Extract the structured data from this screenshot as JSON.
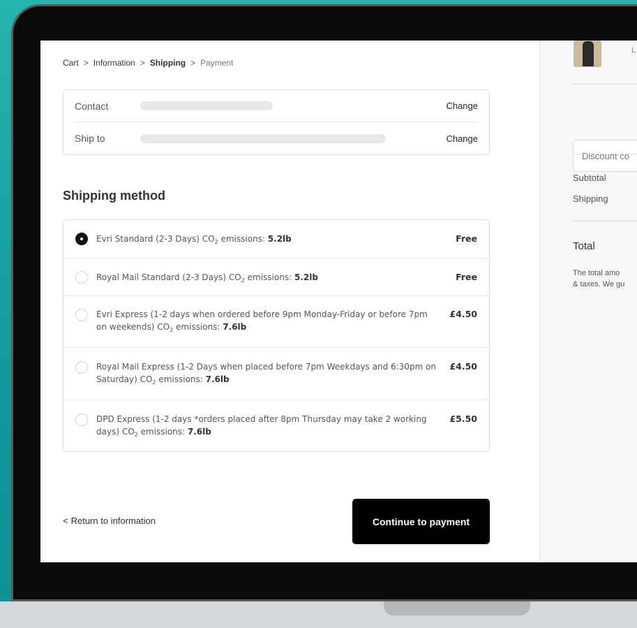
{
  "breadcrumb": {
    "items": [
      "Cart",
      "Information",
      "Shipping",
      "Payment"
    ],
    "separator": ">"
  },
  "summary": {
    "contact_label": "Contact",
    "ship_to_label": "Ship to",
    "change_label": "Change"
  },
  "shipping": {
    "title": "Shipping method",
    "methods": [
      {
        "name": "Evri Standard (2-3 Days)",
        "co2_prefix": "CO",
        "co2_sub": "2",
        "co2_suffix": " emissions: ",
        "co2_value": "5.2lb",
        "price": "Free",
        "selected": true
      },
      {
        "name": "Royal Mail Standard (2-3 Days)",
        "co2_prefix": "CO",
        "co2_sub": "2",
        "co2_suffix": " emissions: ",
        "co2_value": "5.2lb",
        "price": "Free",
        "selected": false
      },
      {
        "name": "Evri Express (1-2 days when ordered before 9pm Monday-Friday or before 7pm on weekends)",
        "co2_prefix": "CO",
        "co2_sub": "2",
        "co2_suffix": " emissions: ",
        "co2_value": "7.6lb",
        "price": "£4.50",
        "selected": false
      },
      {
        "name": "Royal Mail Express (1-2 Days when placed before 7pm Weekdays and 6:30pm on Saturday)",
        "co2_prefix": "CO",
        "co2_sub": "2",
        "co2_suffix": " emissions: ",
        "co2_value": "7.6lb",
        "price": "£4.50",
        "selected": false
      },
      {
        "name": "DPD Express (1-2 days *orders placed after 8pm Thursday may take 2 working days)",
        "co2_prefix": "CO",
        "co2_sub": "2",
        "co2_suffix": " emissions: ",
        "co2_value": "7.6lb",
        "price": "£5.50",
        "selected": false
      }
    ]
  },
  "footer": {
    "return_label": "Return to information",
    "return_chevron": "<",
    "continue_label": "Continue to payment"
  },
  "order_summary": {
    "item_text": "L",
    "discount_placeholder": "Discount co",
    "subtotal_label": "Subtotal",
    "shipping_label": "Shipping",
    "total_label": "Total",
    "note_line1": "The total amo",
    "note_line2": "& taxes. We gu"
  },
  "colors": {
    "background": "#1aa6a3",
    "button": "#000000",
    "selected_radio": "#111111"
  }
}
